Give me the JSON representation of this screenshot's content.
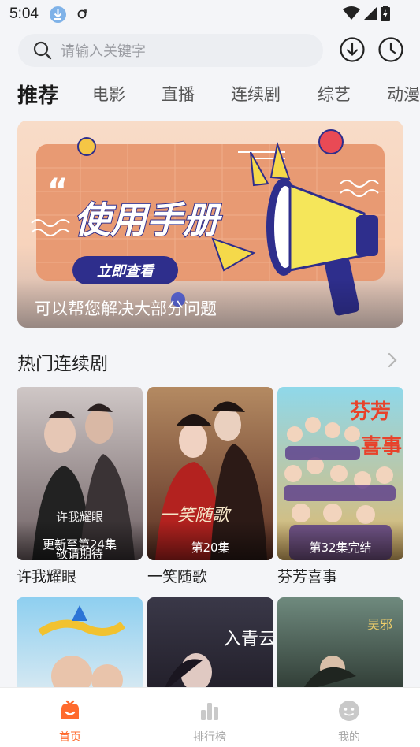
{
  "status_bar": {
    "time": "5:04"
  },
  "search": {
    "placeholder": "请输入关键字"
  },
  "tabs": [
    {
      "label": "推荐",
      "active": true
    },
    {
      "label": "电影"
    },
    {
      "label": "直播"
    },
    {
      "label": "连续剧"
    },
    {
      "label": "综艺"
    },
    {
      "label": "动漫"
    }
  ],
  "banner": {
    "headline": "使用手册",
    "button_label": "立即查看",
    "caption": "可以帮您解决大部分问题"
  },
  "section": {
    "title": "热门连续剧",
    "more_icon": "chevron-right-icon"
  },
  "shows": [
    {
      "title": "许我耀眼",
      "badge": "更新至第24集",
      "badge_note": "敬请期待"
    },
    {
      "title": "一笑随歌",
      "badge": "第20集"
    },
    {
      "title": "芬芳喜事",
      "badge": "第32集完结"
    }
  ],
  "bottom_nav": [
    {
      "label": "首页",
      "icon": "home-icon",
      "active": true
    },
    {
      "label": "排行榜",
      "icon": "ranking-icon"
    },
    {
      "label": "我的",
      "icon": "profile-icon"
    }
  ],
  "colors": {
    "accent": "#ff6a2c",
    "banner_button": "#2e2e8c"
  }
}
